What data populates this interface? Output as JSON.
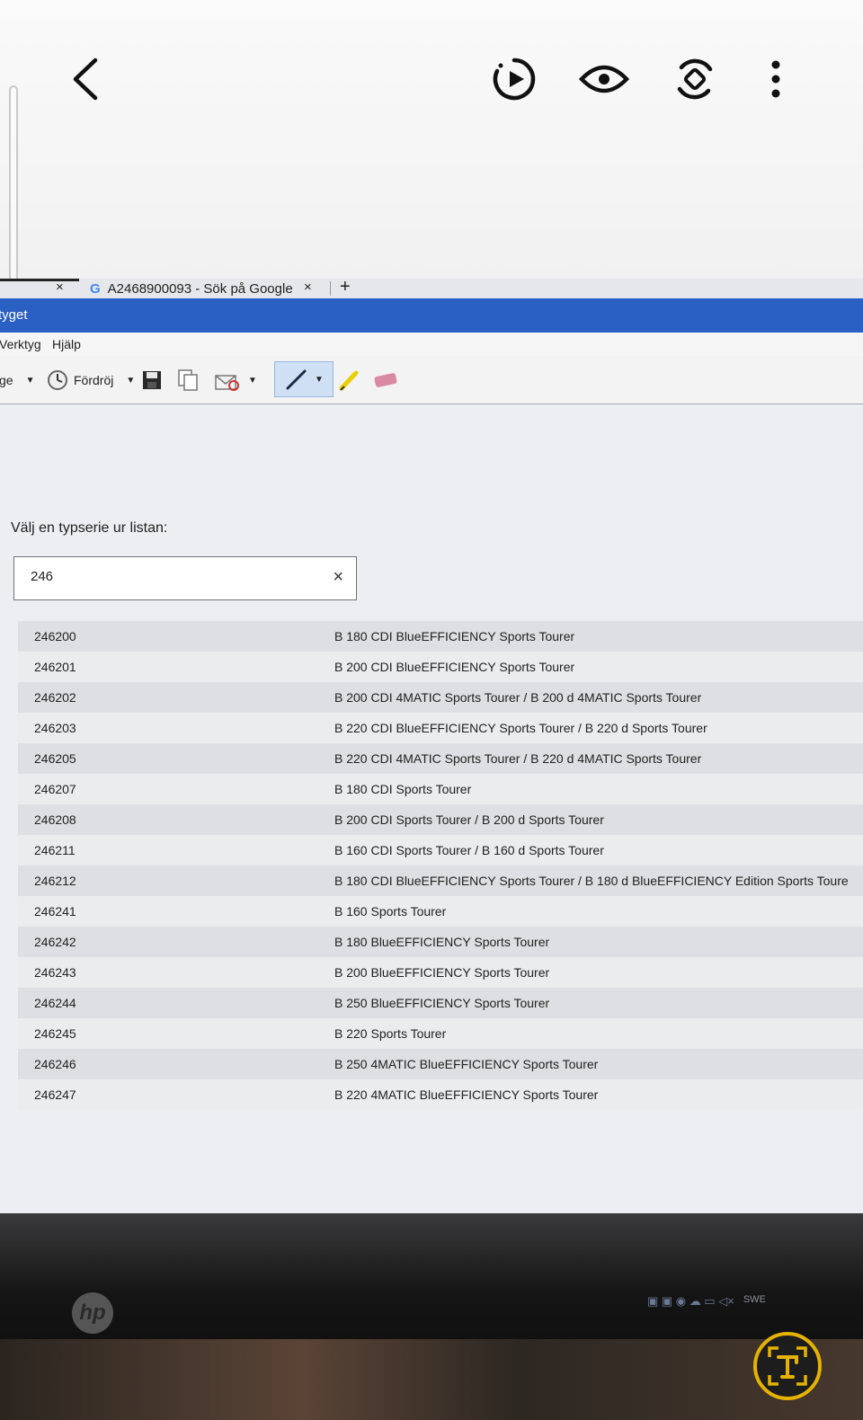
{
  "viewer": {
    "icons": [
      "back-arrow-icon",
      "motion-photo-icon",
      "eye-icon",
      "rotate-icon",
      "more-options-icon",
      "text-scan-icon"
    ]
  },
  "browser": {
    "tab_title": "A2468900093 - Sök på Google",
    "tab_icon_letter": "G",
    "new_tab": "+",
    "close": "×"
  },
  "window": {
    "title": "tyget"
  },
  "menu": {
    "items": [
      "Verktyg",
      "Hjälp"
    ]
  },
  "toolbar": {
    "partial_label": "ge",
    "delay_label": "Fördröj"
  },
  "main": {
    "prompt": "Välj en typserie ur listan:",
    "search_value": "246",
    "clear": "×",
    "rows": [
      {
        "code": "246200",
        "name": "B 180 CDI BlueEFFICIENCY Sports Tourer"
      },
      {
        "code": "246201",
        "name": "B 200 CDI BlueEFFICIENCY Sports Tourer"
      },
      {
        "code": "246202",
        "name": "B 200 CDI 4MATIC Sports Tourer / B 200 d 4MATIC Sports Tourer"
      },
      {
        "code": "246203",
        "name": "B 220 CDI BlueEFFICIENCY Sports Tourer / B 220 d Sports Tourer"
      },
      {
        "code": "246205",
        "name": "B 220 CDI 4MATIC Sports Tourer / B 220 d 4MATIC Sports Tourer"
      },
      {
        "code": "246207",
        "name": "B 180 CDI Sports Tourer"
      },
      {
        "code": "246208",
        "name": "B 200 CDI Sports Tourer / B 200 d Sports Tourer"
      },
      {
        "code": "246211",
        "name": "B 160 CDI Sports Tourer / B 160 d Sports Tourer"
      },
      {
        "code": "246212",
        "name": "B 180 CDI BlueEFFICIENCY Sports Tourer / B 180 d BlueEFFICIENCY Edition Sports Toure"
      },
      {
        "code": "246241",
        "name": "B 160 Sports Tourer"
      },
      {
        "code": "246242",
        "name": "B 180 BlueEFFICIENCY Sports Tourer"
      },
      {
        "code": "246243",
        "name": "B 200 BlueEFFICIENCY Sports Tourer"
      },
      {
        "code": "246244",
        "name": "B 250 BlueEFFICIENCY Sports Tourer"
      },
      {
        "code": "246245",
        "name": "B 220 Sports Tourer"
      },
      {
        "code": "246246",
        "name": "B 250 4MATIC BlueEFFICIENCY Sports Tourer"
      },
      {
        "code": "246247",
        "name": "B 220 4MATIC BlueEFFICIENCY Sports Tourer"
      }
    ]
  },
  "monitor": {
    "logo": "hp",
    "tray_language": "SWE"
  },
  "colors": {
    "titlebar": "#2a5fc3",
    "scan_button_ring": "#e5b200"
  }
}
